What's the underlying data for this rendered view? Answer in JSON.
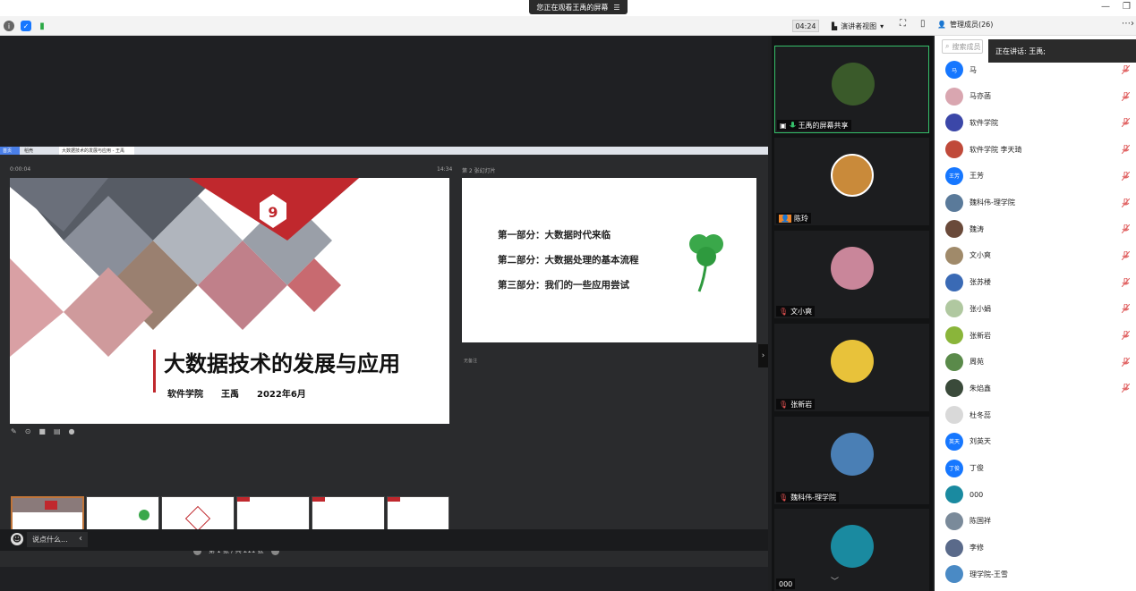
{
  "banner": {
    "text": "您正在观看王禹的屏幕",
    "icon": "stop-share-icon"
  },
  "toolbar": {
    "timer": "04:24",
    "view_label": "演讲者视图",
    "members_label": "管理成员(26)"
  },
  "ppt": {
    "tabs": [
      "首页",
      "稻壳",
      "大数据技术的发展与应用 - 王禹"
    ],
    "elapsed": "0:00:04",
    "clock": "14:34",
    "next_label": "第 2 张幻灯片",
    "slide_title": "大数据技术的发展与应用",
    "slide_subtitle": "软件学院　　王禹　　2022年6月",
    "next_lines": [
      "第一部分：大数据时代来临",
      "第二部分：大数据处理的基本流程",
      "第三部分：我们的一些应用尝试"
    ],
    "notes_label": "无备注",
    "pager": "第 1 张 / 共 211 张"
  },
  "chat": {
    "placeholder": "说点什么..."
  },
  "videos": [
    {
      "name": "王禹的屏幕共享",
      "color": "#3a5a2a"
    },
    {
      "name": "陈玲",
      "color": "#c98a3a"
    },
    {
      "name": "文小爽",
      "color": "#c9869a"
    },
    {
      "name": "张新岩",
      "color": "#e8c23a"
    },
    {
      "name": "魏科伟-理学院",
      "color": "#4a7fb5"
    },
    {
      "name": "000",
      "color": "#1a8aa0"
    }
  ],
  "panel": {
    "search_placeholder": "搜索成员",
    "speaking": "正在讲话: 王禹;",
    "members": [
      {
        "name": "马",
        "color": "#1677ff",
        "muted": true,
        "initial": "马"
      },
      {
        "name": "马亦菡",
        "color": "#d9a6b0",
        "muted": true,
        "initial": ""
      },
      {
        "name": "软件学院",
        "color": "#3b47a8",
        "muted": true,
        "initial": ""
      },
      {
        "name": "软件学院  李天琦",
        "color": "#c04a3a",
        "muted": true,
        "initial": ""
      },
      {
        "name": "王芳",
        "color": "#1677ff",
        "muted": true,
        "initial": "王芳"
      },
      {
        "name": "魏科伟-理学院",
        "color": "#5a7a9a",
        "muted": true,
        "initial": ""
      },
      {
        "name": "魏涛",
        "color": "#6a4a3a",
        "muted": true,
        "initial": ""
      },
      {
        "name": "文小爽",
        "color": "#a08a6a",
        "muted": true,
        "initial": ""
      },
      {
        "name": "张苏楼",
        "color": "#3a6ab5",
        "muted": true,
        "initial": ""
      },
      {
        "name": "张小娟",
        "color": "#b0c8a0",
        "muted": true,
        "initial": ""
      },
      {
        "name": "张新岩",
        "color": "#8ab53a",
        "muted": true,
        "initial": ""
      },
      {
        "name": "周苑",
        "color": "#5a8a4a",
        "muted": true,
        "initial": ""
      },
      {
        "name": "朱焰鑫",
        "color": "#3a4a3a",
        "muted": true,
        "initial": ""
      },
      {
        "name": "杜冬蕊",
        "color": "#d9d9d9",
        "muted": false,
        "initial": ""
      },
      {
        "name": "刘英天",
        "color": "#1677ff",
        "muted": false,
        "initial": "英天"
      },
      {
        "name": "丁俊",
        "color": "#1677ff",
        "muted": false,
        "initial": "丁俊"
      },
      {
        "name": "000",
        "color": "#1a8aa0",
        "muted": false,
        "initial": ""
      },
      {
        "name": "陈国祥",
        "color": "#7a8a9a",
        "muted": false,
        "initial": ""
      },
      {
        "name": "李修",
        "color": "#5a6a8a",
        "muted": false,
        "initial": ""
      },
      {
        "name": "理学院-王雪",
        "color": "#4a8ac5",
        "muted": false,
        "initial": ""
      }
    ]
  }
}
